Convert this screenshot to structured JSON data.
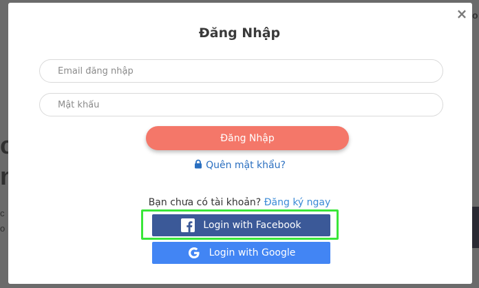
{
  "background": {
    "text_big1": "c",
    "text_big2": "n",
    "text_sm1": "c",
    "text_sm2": "o",
    "text_r1": "o"
  },
  "modal": {
    "close_label": "×",
    "title": "Đăng Nhập",
    "email": {
      "value": "",
      "placeholder": "Email đăng nhập"
    },
    "password": {
      "value": "",
      "placeholder": "Mật khẩu"
    },
    "login_button_label": "Đăng Nhập",
    "forgot_password_label": "Quên mật khẩu?",
    "signup_prompt": "Bạn chưa có tài khoản?",
    "signup_link_label": "Đăng ký ngay",
    "facebook_button_label": "Login with Facebook",
    "google_button_label": "Login with Google"
  },
  "colors": {
    "primary_button": "#f47769",
    "link": "#2a6fc0",
    "facebook": "#3b5998",
    "google": "#4285f4",
    "highlight": "#39e639"
  },
  "icons": {
    "close": "close-icon",
    "lock": "lock-icon",
    "facebook": "facebook-icon",
    "google": "google-icon"
  }
}
